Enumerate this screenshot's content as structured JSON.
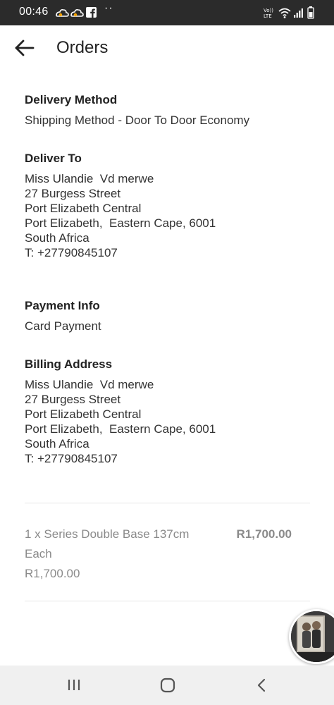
{
  "status_bar": {
    "time": "00:46",
    "dots": "··"
  },
  "header": {
    "title": "Orders"
  },
  "delivery_method": {
    "title": "Delivery Method",
    "value": "Shipping Method - Door To Door Economy"
  },
  "deliver_to": {
    "title": "Deliver To",
    "lines": [
      "Miss Ulandie  Vd merwe",
      "27 Burgess Street",
      "Port Elizabeth Central",
      "Port Elizabeth,  Eastern Cape, 6001",
      "South Africa",
      "T: +27790845107"
    ]
  },
  "payment_info": {
    "title": "Payment Info",
    "value": "Card Payment"
  },
  "billing_address": {
    "title": "Billing Address",
    "lines": [
      "Miss Ulandie  Vd merwe",
      "27 Burgess Street",
      "Port Elizabeth Central",
      "Port Elizabeth,  Eastern Cape, 6001",
      "South Africa",
      "T: +27790845107"
    ]
  },
  "order_item": {
    "name": "1 x Series Double Base 137cm",
    "price": "R1,700.00",
    "each_label": "Each",
    "subtotal": "R1,700.00"
  },
  "colors": {
    "status_bar_bg": "#2b2b2b",
    "nav_bar_bg": "#f0f0f0",
    "muted_text": "#8a8a8a"
  },
  "icons": {
    "back": "arrow-left-icon",
    "nav_recents": "recent-apps-icon",
    "nav_home": "home-icon",
    "nav_back": "chevron-left-icon"
  }
}
